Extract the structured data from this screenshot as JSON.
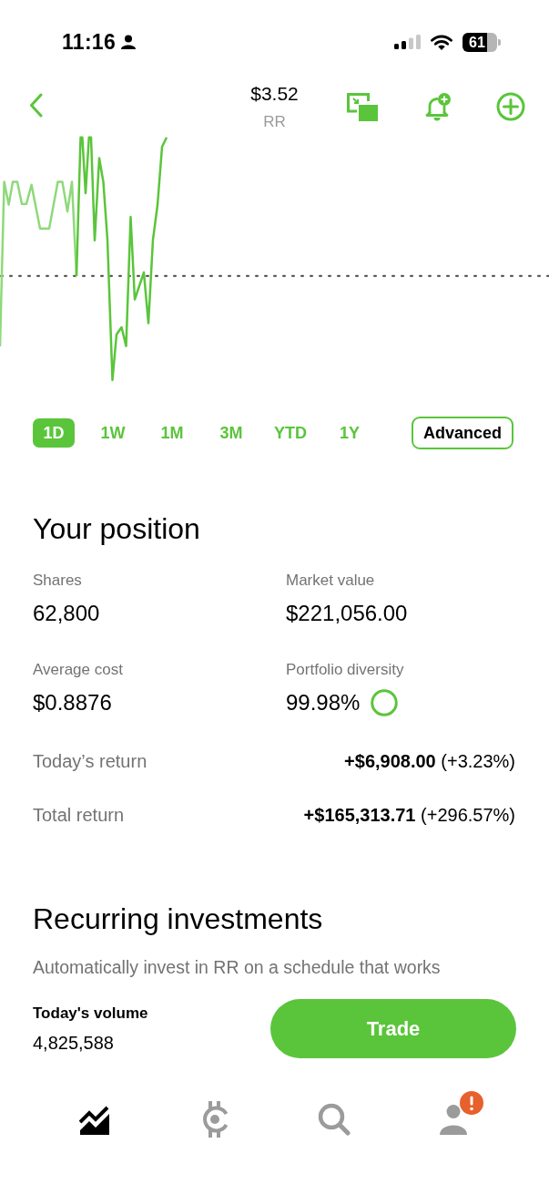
{
  "status_bar": {
    "time": "11:16",
    "battery": "61"
  },
  "header": {
    "price": "$3.52",
    "symbol": "RR"
  },
  "timeframes": [
    {
      "label": "1D",
      "selected": true
    },
    {
      "label": "1W",
      "selected": false
    },
    {
      "label": "1M",
      "selected": false
    },
    {
      "label": "3M",
      "selected": false
    },
    {
      "label": "YTD",
      "selected": false
    },
    {
      "label": "1Y",
      "selected": false
    }
  ],
  "advanced_button": {
    "label": "Advanced"
  },
  "position": {
    "title": "Your position",
    "stats": [
      {
        "label": "Shares",
        "value": "62,800",
        "kind": "plain"
      },
      {
        "label": "Market value",
        "value": "$221,056.00",
        "kind": "plain"
      },
      {
        "label": "Average cost",
        "value": "$0.8876",
        "kind": "plain"
      },
      {
        "label": "Portfolio diversity",
        "value": "99.98%",
        "kind": "ring"
      }
    ],
    "returns": [
      {
        "label": "Today’s return",
        "value": "**+$6,908.00** (+3.23%)"
      },
      {
        "label": "Total return",
        "value": "**+$165,313.71** (+296.57%)"
      }
    ]
  },
  "recurring": {
    "title": "Recurring investments",
    "description": "Automatically invest in RR on a schedule that works"
  },
  "volume": {
    "label": "Today's volume",
    "value": "4,825,588"
  },
  "trade_button": {
    "label": "Trade"
  },
  "tab_bar": [
    {
      "kind": "chart",
      "selected": true,
      "alert": false
    },
    {
      "kind": "coin",
      "selected": false,
      "alert": false
    },
    {
      "kind": "search",
      "selected": false,
      "alert": false
    },
    {
      "kind": "account",
      "selected": false,
      "alert": true
    }
  ]
}
